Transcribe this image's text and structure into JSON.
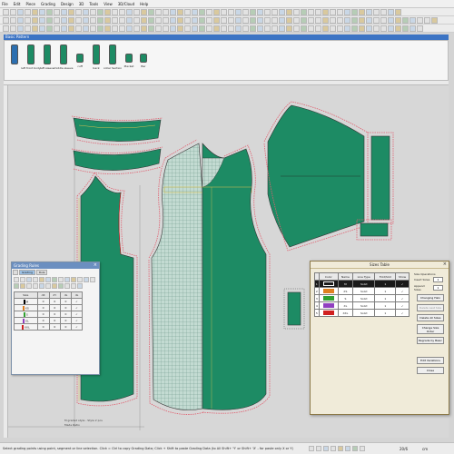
{
  "menu": [
    "File",
    "Edit",
    "Piece",
    "Grading",
    "Design",
    "3D",
    "Tools",
    "View",
    "3D/Cloud",
    "Help"
  ],
  "piece_bar": {
    "title": "Basic Pattern",
    "items": [
      {
        "label": "",
        "selected": true,
        "small": false
      },
      {
        "label": "left front body",
        "selected": false,
        "small": false
      },
      {
        "label": "left sleeve",
        "selected": false,
        "small": false
      },
      {
        "label": "middle sleeve",
        "selected": false,
        "small": false
      },
      {
        "label": "cuff",
        "selected": false,
        "small": true
      },
      {
        "label": "back",
        "selected": false,
        "small": false
      },
      {
        "label": "collar Section",
        "selected": false,
        "small": false
      },
      {
        "label": "Placket",
        "selected": false,
        "small": true
      },
      {
        "label": "Bar",
        "selected": false,
        "small": true
      }
    ]
  },
  "colors": {
    "piece_fill": "#1d8b64",
    "grid_fill": "#bcd7cf",
    "grade_pink": "#e06070",
    "grade_red": "#d02020",
    "grade_yellow": "#d8c050",
    "outline": "#333333",
    "title_blue": "#3c74c4"
  },
  "grading_window": {
    "title": "Grading Rules",
    "tabs": [
      "",
      "Grading",
      "Rule"
    ],
    "headers": [
      "Size",
      "dX",
      "dY",
      "dL",
      "dL"
    ],
    "rows": [
      {
        "size": "M",
        "color": "#000000",
        "dx": "0",
        "dy": "0",
        "dl": "0",
        "chk": "✓"
      },
      {
        "size": "XS",
        "color": "#e08020",
        "dx": "0",
        "dy": "0",
        "dl": "0",
        "chk": "✓"
      },
      {
        "size": "S",
        "color": "#30a030",
        "dx": "0",
        "dy": "0",
        "dl": "0",
        "chk": "✓"
      },
      {
        "size": "XL",
        "color": "#9040c0",
        "dx": "0",
        "dy": "0",
        "dl": "0",
        "chk": "✓"
      },
      {
        "size": "XXL",
        "color": "#d02020",
        "dx": "0",
        "dy": "0",
        "dl": "0",
        "chk": "✓"
      }
    ]
  },
  "sizes_window": {
    "title": "Sizes Table",
    "headers": [
      "",
      "Color",
      "Name",
      "Line Type",
      "Fold/Slot",
      "Show"
    ],
    "rows": [
      {
        "num": "1",
        "color": "#1a1a1a",
        "name": "M",
        "linetype": "Solid",
        "fold": "1",
        "show": "✓",
        "selected": true
      },
      {
        "num": "2",
        "color": "#e08020",
        "name": "XS",
        "linetype": "Solid",
        "fold": "1",
        "show": "✓",
        "selected": false
      },
      {
        "num": "3",
        "color": "#30a030",
        "name": "S",
        "linetype": "Solid",
        "fold": "1",
        "show": "✓",
        "selected": false
      },
      {
        "num": "4",
        "color": "#9040c0",
        "name": "XL",
        "linetype": "Solid",
        "fold": "1",
        "show": "✓",
        "selected": false
      },
      {
        "num": "5",
        "color": "#d02020",
        "name": "XXL",
        "linetype": "Solid",
        "fold": "1",
        "show": "✓",
        "selected": false
      }
    ],
    "operations_label": "Size Operations",
    "insert_label": "Insert Sizes",
    "insert_value": "1",
    "append_label": "Append Sizes",
    "append_value": "1",
    "buttons": {
      "changing": "Changing Halo",
      "delete_size": "Delete Last Size",
      "delete_all": "Delete All Sizes",
      "change_order": "Change Size Order",
      "regrade": "Regrade by Basic",
      "edit_variations": "Edit Variations",
      "close": "Close"
    }
  },
  "status": {
    "text": "Select grading points using point, segment or line selection. Click = Ctrl to copy Grading Data; Click + Shift to paste Grading Data (to All Shift+ 'Y' or Shift+ 'X' - for paste only X or Y)",
    "value": "20/6",
    "unit": "cm"
  },
  "canvas_notes": {
    "bottom": "M graded style - Style 2 pcs",
    "bottom2": "Made Ratio"
  }
}
